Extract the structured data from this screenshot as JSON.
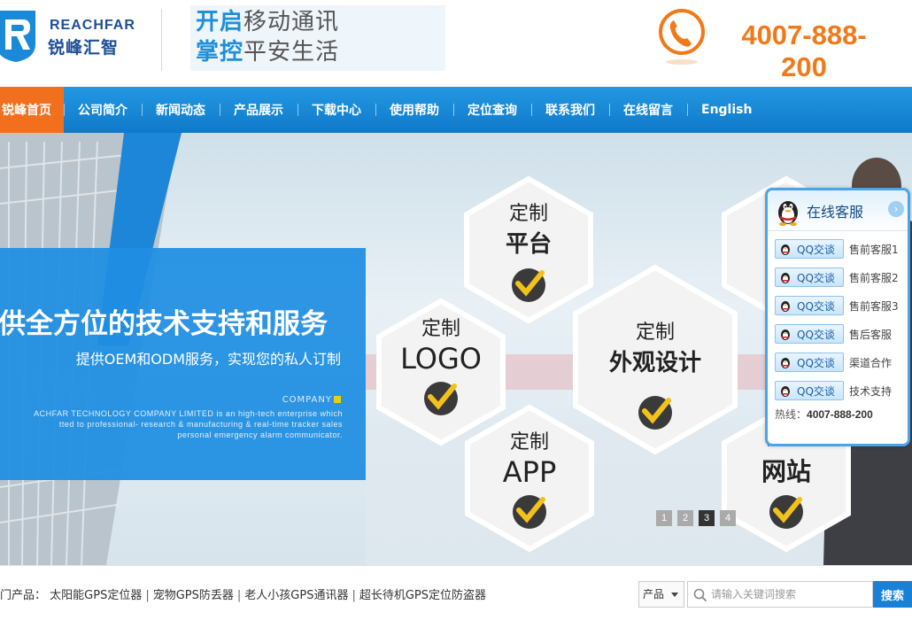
{
  "header": {
    "brand_en": "REACHFAR",
    "brand_cn": "锐峰汇智",
    "slogan_line1_highlight": "开启",
    "slogan_line1_rest": "移动通讯",
    "slogan_line2_highlight": "掌控",
    "slogan_line2_rest": "平安生活",
    "phone": "4007-888-200",
    "icons": {
      "logo": "reachfar-logo",
      "phone": "phone-icon"
    }
  },
  "nav": {
    "items": [
      {
        "label": "锐峰首页",
        "active": true
      },
      {
        "label": "公司简介"
      },
      {
        "label": "新闻动态"
      },
      {
        "label": "产品展示"
      },
      {
        "label": "下载中心"
      },
      {
        "label": "使用帮助"
      },
      {
        "label": "定位查询"
      },
      {
        "label": "联系我们"
      },
      {
        "label": "在线留言"
      },
      {
        "label": "English"
      }
    ]
  },
  "banner": {
    "title": "供全方位的技术支持和服务",
    "subtitle": "提供OEM和ODM服务，实现您的私人订制",
    "company_label": "COMPANY",
    "company_desc_line1": "ACHFAR TECHNOLOGY COMPANY LIMITED is an high-tech enterprise which",
    "company_desc_line2": "tted to professional- research & manufacturing & real-time tracker sales",
    "company_desc_line3": "personal emergency alarm communicator.",
    "hexes": [
      {
        "top": "定制",
        "main": "平台"
      },
      {
        "top": "定制",
        "main": "LOGO"
      },
      {
        "top": "定制",
        "main": "外观设计"
      },
      {
        "top": "定制",
        "main": "APP"
      },
      {
        "top": "定制",
        "main": "网站"
      }
    ],
    "pager": [
      "1",
      "2",
      "3",
      "4"
    ],
    "pager_active": 3
  },
  "customer_service": {
    "title": "在线客服",
    "button_label": "QQ交谈",
    "rows": [
      {
        "role": "售前客服1"
      },
      {
        "role": "售前客服2"
      },
      {
        "role": "售前客服3"
      },
      {
        "role": "售后客服"
      },
      {
        "role": "渠道合作"
      },
      {
        "role": "技术支持"
      }
    ],
    "hotline_label": "热线：",
    "hotline_number": "4007-888-200"
  },
  "footer": {
    "hot_label": "门产品：",
    "hot_products": [
      "太阳能GPS定位器",
      "宠物GPS防丢器",
      "老人小孩GPS通讯器",
      "超长待机GPS定位防盗器"
    ],
    "separator": "|",
    "search_category": "产品",
    "search_placeholder": "请输入关键词搜索",
    "search_button": "搜索"
  },
  "colors": {
    "nav_blue": "#1587d6",
    "active_orange": "#f2701d",
    "phone_orange": "#f07a1a",
    "brand_blue": "#1d4f96",
    "banner_blue": "#1e8ee2"
  }
}
